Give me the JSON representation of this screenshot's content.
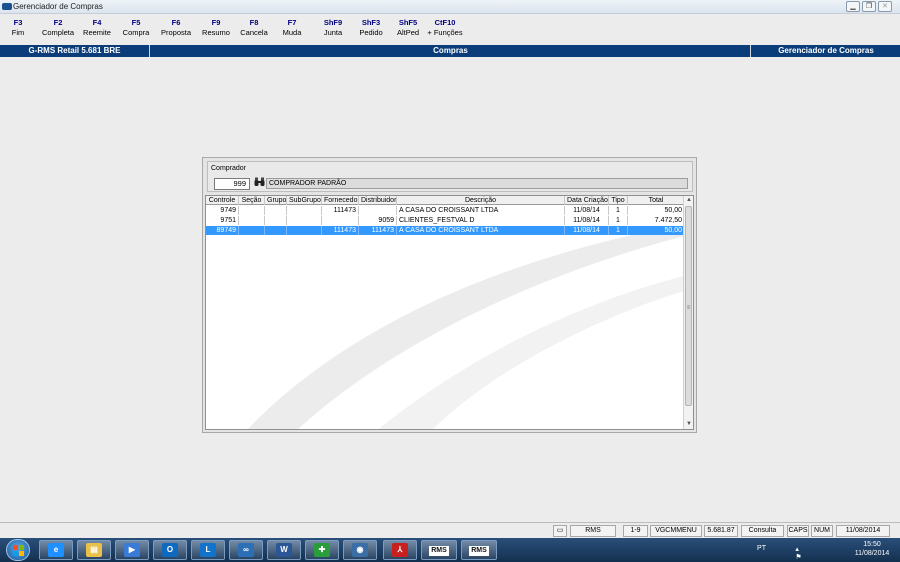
{
  "window": {
    "title": "Gerenciador de Compras",
    "controls": [
      "minimize-icon",
      "restore-icon",
      "close-icon"
    ]
  },
  "fkeys": [
    {
      "key": "F3",
      "label": "Fim"
    },
    {
      "key": "F2",
      "label": "Completa"
    },
    {
      "key": "F4",
      "label": "Reemite"
    },
    {
      "key": "F5",
      "label": "Compra"
    },
    {
      "key": "F6",
      "label": "Proposta"
    },
    {
      "key": "F9",
      "label": "Resumo"
    },
    {
      "key": "F8",
      "label": "Cancela"
    },
    {
      "key": "F7",
      "label": "Muda"
    },
    {
      "key": "ShF9",
      "label": "Junta"
    },
    {
      "key": "ShF3",
      "label": "Pedido"
    },
    {
      "key": "ShF5",
      "label": "AltPed"
    },
    {
      "key": "CtF10",
      "label": "+ Funções"
    }
  ],
  "header": {
    "system": "G-RMS Retail 5.681 BRE",
    "module": "Compras",
    "context": "Gerenciador de Compras"
  },
  "comprador": {
    "caption": "Comprador",
    "code": "999",
    "name": "COMPRADOR PADRÃO",
    "search_icon": "binoculars-icon"
  },
  "grid": {
    "columns": [
      "Controle",
      "Seção",
      "Grupo",
      "SubGrupo",
      "Fornecedor",
      "Distribuidor",
      "Descrição",
      "Data Criação",
      "Tipo",
      "Total"
    ],
    "rows": [
      {
        "controle": "9749",
        "secao": "",
        "grupo": "",
        "subgrupo": "",
        "fornecedor": "111473",
        "distribuidor": "",
        "descricao": "A CASA DO CROISSANT LTDA",
        "data": "11/08/14",
        "tipo": "1",
        "total": "50,00",
        "selected": false
      },
      {
        "controle": "9751",
        "secao": "",
        "grupo": "",
        "subgrupo": "",
        "fornecedor": "",
        "distribuidor": "9059",
        "descricao": "CLIENTES_FESTVAL D",
        "data": "11/08/14",
        "tipo": "1",
        "total": "7.472,50",
        "selected": false
      },
      {
        "controle": "89749",
        "secao": "",
        "grupo": "",
        "subgrupo": "",
        "fornecedor": "111473",
        "distribuidor": "111473",
        "descricao": "A CASA DO CROISSANT LTDA",
        "data": "11/08/14",
        "tipo": "1",
        "total": "50,00",
        "selected": true
      }
    ]
  },
  "statusbar": {
    "cells": [
      "RMS",
      "1-9",
      "VGCMMENU",
      "5.681.87",
      "Consulta",
      "CAPS",
      "NUM",
      "11/08/2014"
    ]
  },
  "taskbar": {
    "apps": [
      "ie-icon",
      "explorer-icon",
      "media-player-icon",
      "outlook-icon",
      "lync-icon",
      "remote-icon",
      "word-icon",
      "store-icon",
      "app-icon",
      "acrobat-icon",
      "rms-icon",
      "rms-icon"
    ],
    "rms1": "RMS",
    "rms2": "RMS",
    "lang": "PT",
    "time": "15:50",
    "date": "11/08/2014"
  },
  "colors": {
    "header_bg": "#0a3d7a",
    "fkey_color": "#000080",
    "selection": "#3399ff"
  }
}
